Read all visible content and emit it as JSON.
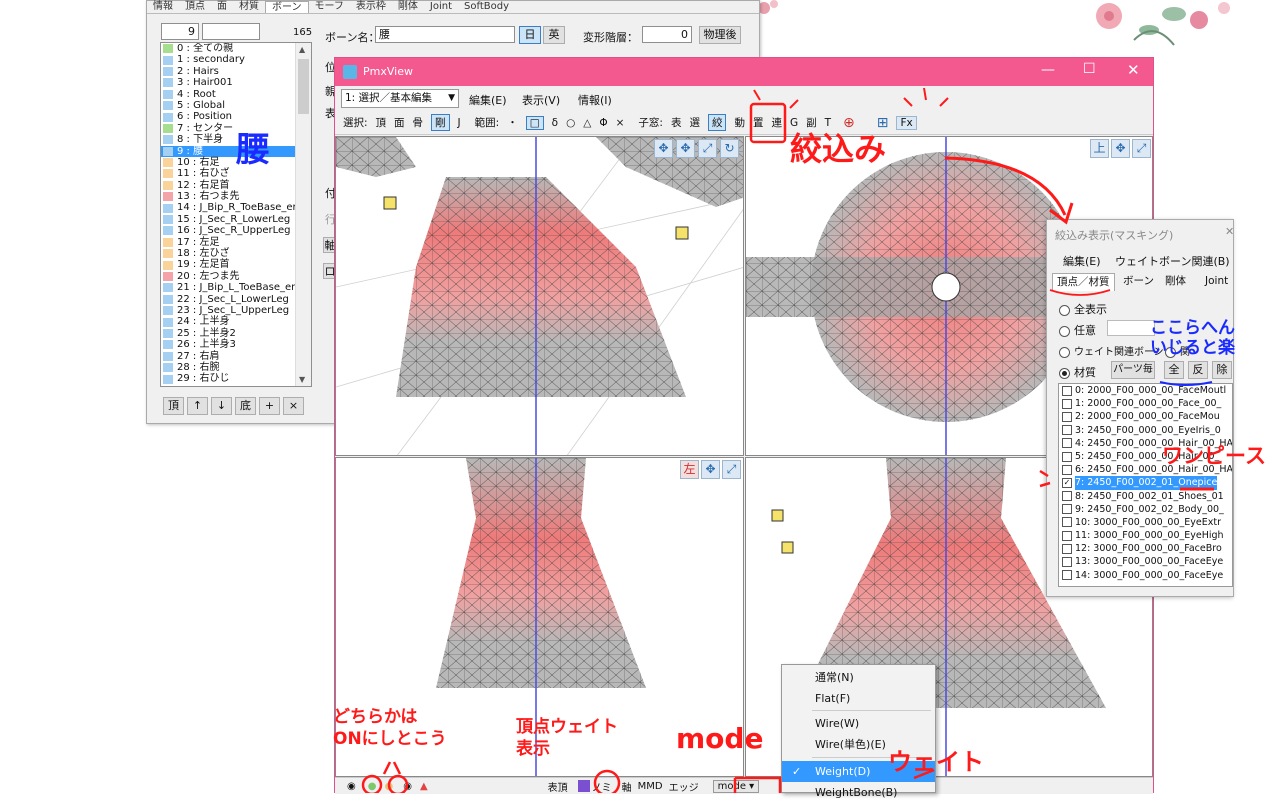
{
  "editor": {
    "tabs": [
      "情報",
      "頂点",
      "面",
      "材質",
      "ボーン",
      "モーフ",
      "表示枠",
      "剛体",
      "Joint",
      "SoftBody"
    ],
    "index_value": "9",
    "count": "165",
    "bone_name_label": "ボーン名：",
    "bone_name_value": "腰",
    "lang_jp": "日",
    "lang_en": "英",
    "deform_layer_label": "変形階層：",
    "deform_layer_value": "0",
    "after_physics": "物理後",
    "side_labels": [
      "位",
      "親",
      "表",
      "付",
      "行"
    ],
    "side_buttons": [
      "軸",
      "ロ"
    ],
    "bones": [
      {
        "label": "0 : 全ての親",
        "color": "#a6dd8f"
      },
      {
        "label": "1 : secondary",
        "color": "#a6d0f2"
      },
      {
        "label": "2 : Hairs",
        "color": "#a6d0f2"
      },
      {
        "label": "3 : Hair001",
        "color": "#a6d0f2"
      },
      {
        "label": "4 : Root",
        "color": "#a6d0f2"
      },
      {
        "label": "5 : Global",
        "color": "#a6d0f2"
      },
      {
        "label": "6 : Position",
        "color": "#a6d0f2"
      },
      {
        "label": "7 : センター",
        "color": "#a6dd8f"
      },
      {
        "label": "8 : 下半身",
        "color": "#a6d0f2"
      },
      {
        "label": "9 : 腰",
        "color": "#a6d0f2",
        "selected": true
      },
      {
        "label": "10 : 右足",
        "color": "#f9d39a"
      },
      {
        "label": "11 : 右ひざ",
        "color": "#f9d39a"
      },
      {
        "label": "12 : 右足首",
        "color": "#f9d39a"
      },
      {
        "label": "13 : 右つま先",
        "color": "#f4a3a8"
      },
      {
        "label": "14 : J_Bip_R_ToeBase_er",
        "color": "#a6d0f2"
      },
      {
        "label": "15 : J_Sec_R_LowerLeg",
        "color": "#a6d0f2"
      },
      {
        "label": "16 : J_Sec_R_UpperLeg",
        "color": "#a6d0f2"
      },
      {
        "label": "17 : 左足",
        "color": "#f9d39a"
      },
      {
        "label": "18 : 左ひざ",
        "color": "#f9d39a"
      },
      {
        "label": "19 : 左足首",
        "color": "#f9d39a"
      },
      {
        "label": "20 : 左つま先",
        "color": "#f4a3a8"
      },
      {
        "label": "21 : J_Bip_L_ToeBase_en",
        "color": "#a6d0f2"
      },
      {
        "label": "22 : J_Sec_L_LowerLeg",
        "color": "#a6d0f2"
      },
      {
        "label": "23 : J_Sec_L_UpperLeg",
        "color": "#a6d0f2"
      },
      {
        "label": "24 : 上半身",
        "color": "#a6d0f2"
      },
      {
        "label": "25 : 上半身2",
        "color": "#a6d0f2"
      },
      {
        "label": "26 : 上半身3",
        "color": "#a6d0f2"
      },
      {
        "label": "27 : 右肩",
        "color": "#a6d0f2"
      },
      {
        "label": "28 : 右腕",
        "color": "#a6d0f2"
      },
      {
        "label": "29 : 右ひじ",
        "color": "#a6d0f2"
      }
    ],
    "list_buttons": [
      "頂",
      "↑",
      "↓",
      "底",
      "+",
      "×"
    ]
  },
  "pmxview": {
    "title": "PmxView",
    "mode_select": "1: 選択／基本編集",
    "menus": [
      "編集(E)",
      "表示(V)",
      "情報(I)"
    ],
    "toolbar_select_label": "選択:",
    "toolbar_select_items": [
      "頂",
      "面",
      "骨",
      "剛",
      "J"
    ],
    "toolbar_range_label": "範囲:",
    "toolbar_range_items": [
      "・",
      "□",
      "δ",
      "○",
      "△",
      "Φ",
      "×"
    ],
    "toolbar_sub_label": "子窓:",
    "toolbar_sub_items": [
      "表",
      "選",
      "絞",
      "動",
      "置",
      "連",
      "G",
      "副",
      "T"
    ],
    "toolbar_fx": "Fx",
    "viewport_labels": [
      "上",
      "左"
    ],
    "bottom_labels": [
      "表頂",
      "ノミ",
      "軸",
      "MMD",
      "エッジ"
    ],
    "mode_button": "mode"
  },
  "mode_menu": {
    "items": [
      "通常(N)",
      "Flat(F)",
      "Wire(W)",
      "Wire(単色)(E)",
      "Weight(D)",
      "WeightBone(B)"
    ],
    "selected": "Weight(D)"
  },
  "masking": {
    "title": "絞込み表示(マスキング)",
    "menus": [
      "編集(E)",
      "ウェイトボーン関連(B)"
    ],
    "tabs": [
      "頂点／材質",
      "ボーン",
      "剛体",
      "Joint"
    ],
    "radio_all": "全表示",
    "radio_any": "任意",
    "radio_weight": "ウェイト関連ボーン",
    "radio_other": "関",
    "radio_material": "材質",
    "btn_parts": "パーツ毎",
    "btn_all": "全",
    "btn_invert": "反",
    "btn_remove": "除",
    "materials": [
      {
        "label": "0: 2000_F00_000_00_FaceMoutl",
        "checked": false
      },
      {
        "label": "1: 2000_F00_000_00_Face_00_",
        "checked": false
      },
      {
        "label": "2: 2000_F00_000_00_FaceMou",
        "checked": false
      },
      {
        "label": "3: 2450_F00_000_00_EyeIris_0",
        "checked": false
      },
      {
        "label": "4: 2450_F00_000_00_Hair_00_HAI",
        "checked": false
      },
      {
        "label": "5: 2450_F00_000_00_Hair_00_",
        "checked": false
      },
      {
        "label": "6: 2450_F00_000_00_Hair_00_HAI",
        "checked": false
      },
      {
        "label": "7: 2450_F00_002_01_Onepice",
        "checked": true,
        "selected": true
      },
      {
        "label": "8: 2450_F00_002_01_Shoes_01",
        "checked": false
      },
      {
        "label": "9: 2450_F00_002_02_Body_00_",
        "checked": false
      },
      {
        "label": "10: 3000_F00_000_00_EyeExtr",
        "checked": false
      },
      {
        "label": "11: 3000_F00_000_00_EyeHigh",
        "checked": false
      },
      {
        "label": "12: 3000_F00_000_00_FaceBro",
        "checked": false
      },
      {
        "label": "13: 3000_F00_000_00_FaceEye",
        "checked": false
      },
      {
        "label": "14: 3000_F00_000_00_FaceEye",
        "checked": false
      }
    ]
  },
  "annotations": {
    "waist": "腰",
    "narrow": "絞込み",
    "here_easy": "ここらへん\nいじると楽",
    "onepiece": "ワンピース",
    "either_on": "どちらかは\nONにしとこう",
    "vertex_weight": "頂点ウェイト\n表示",
    "mode": "mode",
    "weight": "ウェイト"
  },
  "colors": {
    "titlebar": "#f3588f",
    "selection": "#3399ff",
    "annotation_red": "#ff1a1a",
    "annotation_blue": "#1a2bff",
    "mesh_pink": "#ef7a7a",
    "mesh_gray": "#b8b8b8",
    "bone_blue": "#4b4be0"
  }
}
